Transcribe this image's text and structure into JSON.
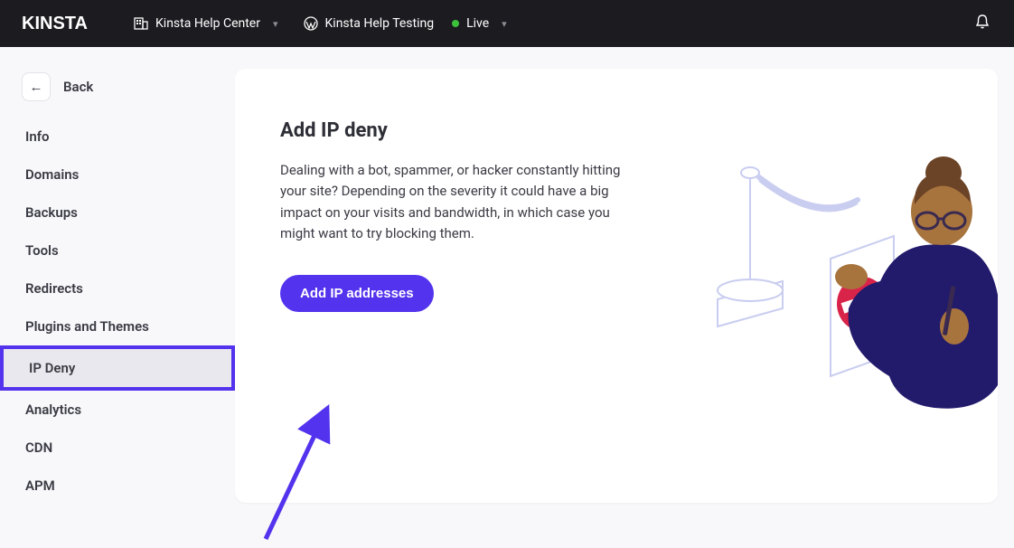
{
  "header": {
    "logo": "KINSTA",
    "company": "Kinsta Help Center",
    "site": "Kinsta Help Testing",
    "env": "Live"
  },
  "sidebar": {
    "back": "Back",
    "items": [
      {
        "label": "Info"
      },
      {
        "label": "Domains"
      },
      {
        "label": "Backups"
      },
      {
        "label": "Tools"
      },
      {
        "label": "Redirects"
      },
      {
        "label": "Plugins and Themes"
      },
      {
        "label": "IP Deny"
      },
      {
        "label": "Analytics"
      },
      {
        "label": "CDN"
      },
      {
        "label": "APM"
      }
    ],
    "active_index": 6
  },
  "main": {
    "heading": "Add IP deny",
    "body": "Dealing with a bot, spammer, or hacker constantly hitting your site? Depending on the severity it could have a big impact on your visits and bandwidth, in which case you might want to try blocking them.",
    "cta": "Add IP addresses"
  }
}
